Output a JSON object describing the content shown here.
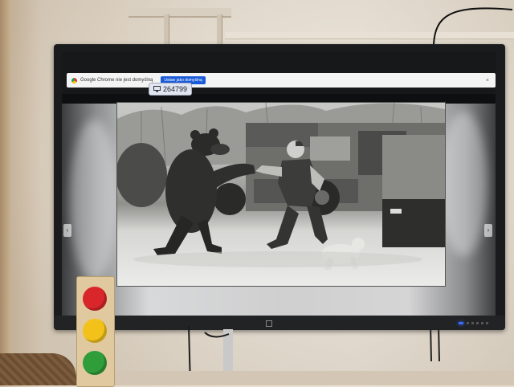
{
  "browser": {
    "notification_text": "Google Chrome nie jest domyślną",
    "notification_button": "Ustaw jako domyślną",
    "close_glyph": "×",
    "counter_icon": "display-icon",
    "counter_value": "264799"
  },
  "viewer": {
    "prev_glyph": "‹",
    "next_glyph": "›",
    "photo_subject": "bear-and-man-photo"
  },
  "colors": {
    "notification_button": "#1a5bd8",
    "tv_led": "#3b6cff",
    "light_red": "#d9262b",
    "light_yellow": "#f2c21b",
    "light_green": "#2f9e3a"
  }
}
